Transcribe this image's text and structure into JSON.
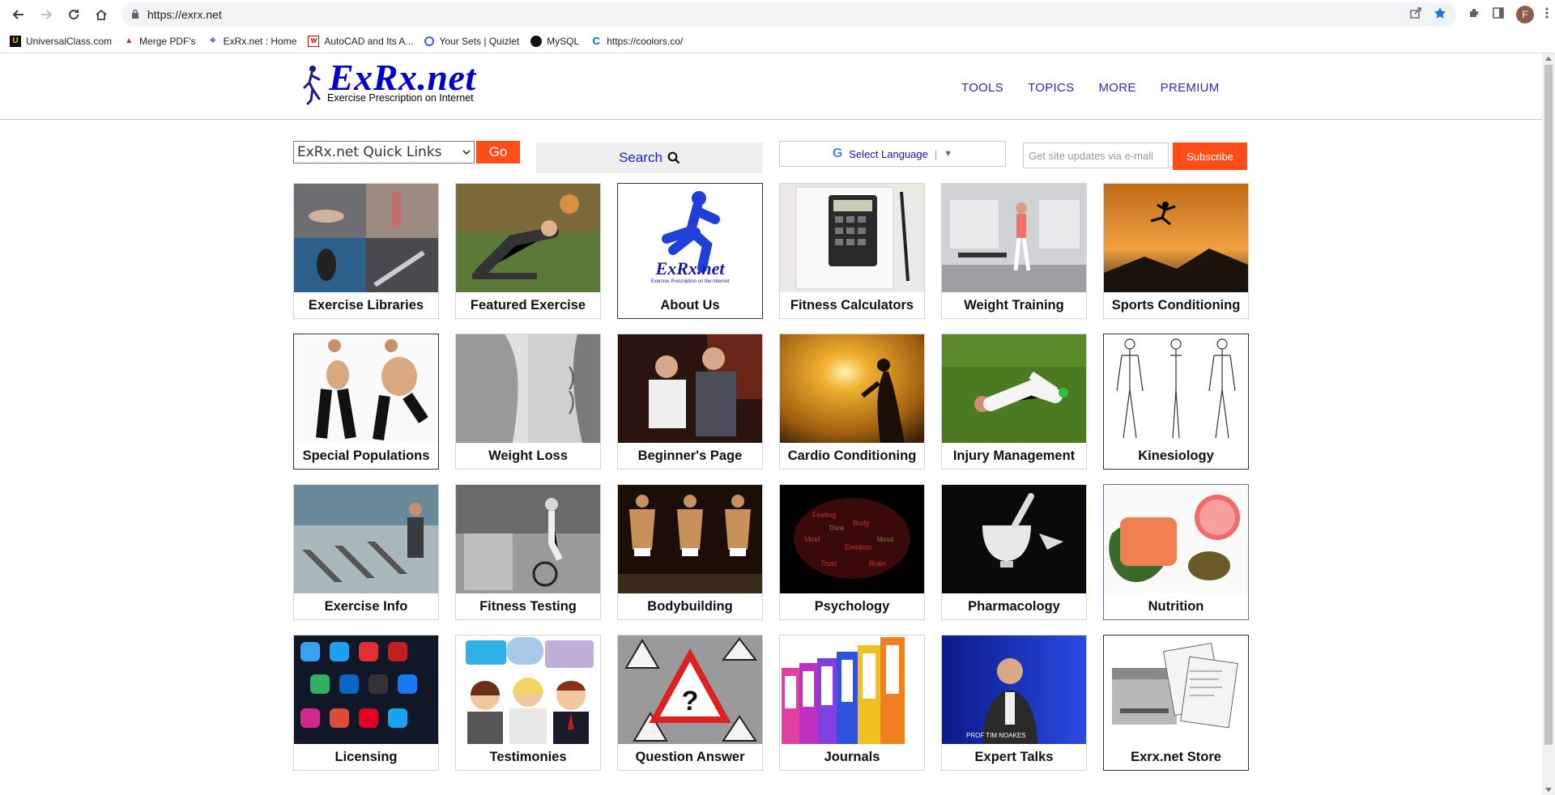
{
  "browser": {
    "url": "https://exrx.net",
    "avatar_letter": "F",
    "bookmarks": [
      {
        "label": "UniversalClass.com",
        "icon": "universalclass-icon"
      },
      {
        "label": "Merge PDF's",
        "icon": "pdf-icon"
      },
      {
        "label": "ExRx.net : Home",
        "icon": "exrx-icon"
      },
      {
        "label": "AutoCAD and Its A...",
        "icon": "autocad-icon"
      },
      {
        "label": "Your Sets | Quizlet",
        "icon": "quizlet-icon"
      },
      {
        "label": "MySQL",
        "icon": "github-icon"
      },
      {
        "label": "https://coolors.co/",
        "icon": "coolors-icon"
      }
    ]
  },
  "site": {
    "logo_title": "ExRx.net",
    "logo_subtitle": "Exercise Prescription on Internet",
    "nav": [
      "TOOLS",
      "TOPICS",
      "MORE",
      "PREMIUM"
    ],
    "quick_links_label": "ExRx.net Quick Links",
    "go_label": "Go",
    "search_label": "Search",
    "language_label": "Select Language",
    "email_placeholder": "Get site updates via e-mail",
    "subscribe_label": "Subscribe",
    "colors": {
      "brand_blue": "#0000cc",
      "accent_orange": "#ff4d1a",
      "nav_blue": "#2b2bb5"
    }
  },
  "tiles": [
    {
      "label": "Exercise Libraries",
      "image": "exercise-collage"
    },
    {
      "label": "Featured Exercise",
      "image": "man-exercising-outdoors"
    },
    {
      "label": "About Us",
      "image": "exrx-logo-runner"
    },
    {
      "label": "Fitness Calculators",
      "image": "calculator-notebook"
    },
    {
      "label": "Weight Training",
      "image": "woman-in-gym"
    },
    {
      "label": "Sports Conditioning",
      "image": "jumping-silhouette-sunset"
    },
    {
      "label": "Special Populations",
      "image": "pregnant-woman"
    },
    {
      "label": "Weight Loss",
      "image": "abdomen-comparison"
    },
    {
      "label": "Beginner's Page",
      "image": "trainer-with-client"
    },
    {
      "label": "Cardio Conditioning",
      "image": "runner-sunset"
    },
    {
      "label": "Injury Management",
      "image": "injured-soccer-player"
    },
    {
      "label": "Kinesiology",
      "image": "skeleton-diagrams"
    },
    {
      "label": "Exercise Info",
      "image": "treadmills"
    },
    {
      "label": "Fitness Testing",
      "image": "vintage-bike-test"
    },
    {
      "label": "Bodybuilding",
      "image": "bodybuilders-posing"
    },
    {
      "label": "Psychology",
      "image": "word-cloud-brain"
    },
    {
      "label": "Pharmacology",
      "image": "mortar-and-pestle"
    },
    {
      "label": "Nutrition",
      "image": "salmon-and-grapefruit"
    },
    {
      "label": "Licensing",
      "image": "social-media-apps"
    },
    {
      "label": "Testimonies",
      "image": "people-speech-bubbles"
    },
    {
      "label": "Question Answer",
      "image": "question-warning-signs"
    },
    {
      "label": "Journals",
      "image": "colored-binders"
    },
    {
      "label": "Expert Talks",
      "image": "speaker-presentation"
    },
    {
      "label": "Exrx.net Store",
      "image": "printer-with-sheets"
    }
  ]
}
